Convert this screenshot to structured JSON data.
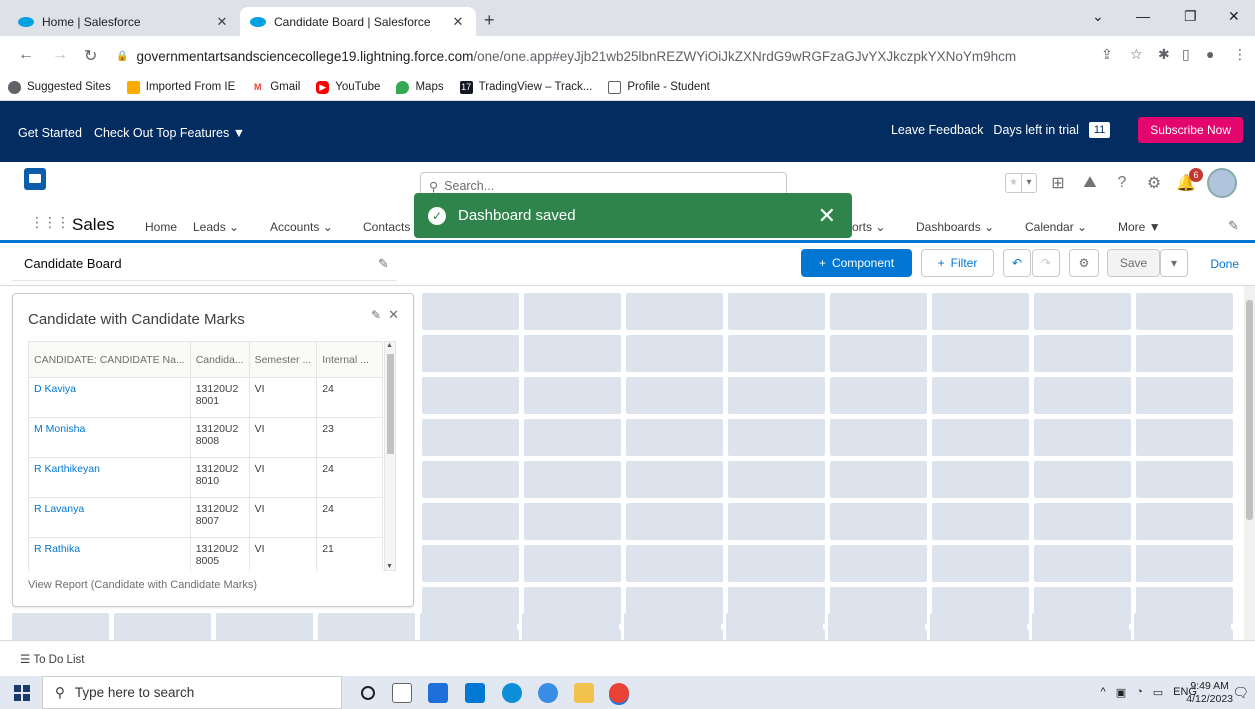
{
  "browser": {
    "tabs": [
      {
        "title": "Home | Salesforce",
        "active": false
      },
      {
        "title": "Candidate Board | Salesforce",
        "active": true
      }
    ],
    "new_tab": "+",
    "url_host": "governmentartsandsciencecollege19.lightning.force.com",
    "url_path": "/one/one.app#eyJjb21wb25lbnREZWYiOiJkZXNrdG9wRGFzaGJvYXJkczpkYXNoYm9hcmQiLCJhdHRyaWJ1d...",
    "bookmarks": [
      "Suggested Sites",
      "Imported From IE",
      "Gmail",
      "YouTube",
      "Maps",
      "TradingView – Track...",
      "Profile - Student"
    ]
  },
  "trial": {
    "get_started": "Get Started",
    "check_out": "Check Out Top Features",
    "leave_feedback": "Leave Feedback",
    "days_left": "Days left in trial",
    "days_count": "11",
    "subscribe": "Subscribe Now"
  },
  "header": {
    "search_placeholder": "Search...",
    "notification_count": "6"
  },
  "nav": {
    "app_name": "Sales",
    "items": [
      "Home",
      "Leads",
      "Accounts",
      "Contacts",
      "orts",
      "Dashboards",
      "Calendar",
      "More"
    ]
  },
  "toast": {
    "message": "Dashboard saved"
  },
  "dashboard": {
    "name": "Candidate Board",
    "component_btn": "Component",
    "filter_btn": "Filter",
    "save_btn": "Save",
    "done_btn": "Done"
  },
  "widget": {
    "title": "Candidate with Candidate Marks",
    "columns": [
      "CANDIDATE: CANDIDATE Na...",
      "Candida...",
      "Semester ...",
      "Internal ..."
    ],
    "rows": [
      {
        "name": "D Kaviya",
        "code": "13120U2 8001",
        "semester": "VI",
        "internal": "24"
      },
      {
        "name": "M Monisha",
        "code": "13120U2 8008",
        "semester": "VI",
        "internal": "23"
      },
      {
        "name": "R Karthikeyan",
        "code": "13120U2 8010",
        "semester": "VI",
        "internal": "24"
      },
      {
        "name": "R Lavanya",
        "code": "13120U2 8007",
        "semester": "VI",
        "internal": "24"
      },
      {
        "name": "R Rathika",
        "code": "13120U2 8005",
        "semester": "VI",
        "internal": "21"
      }
    ],
    "footer": "View Report (Candidate with Candidate Marks)"
  },
  "utility": {
    "todo": "To Do List"
  },
  "taskbar": {
    "search_placeholder": "Type here to search",
    "lang": "ENG",
    "time": "9:49 AM",
    "date": "4/12/2023"
  }
}
